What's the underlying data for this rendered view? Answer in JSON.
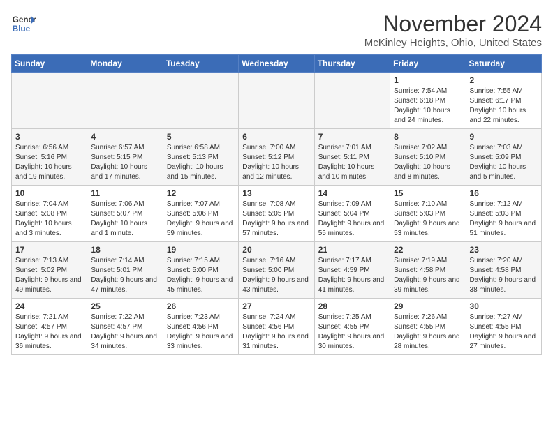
{
  "header": {
    "logo_line1": "General",
    "logo_line2": "Blue",
    "month": "November 2024",
    "location": "McKinley Heights, Ohio, United States"
  },
  "days_of_week": [
    "Sunday",
    "Monday",
    "Tuesday",
    "Wednesday",
    "Thursday",
    "Friday",
    "Saturday"
  ],
  "weeks": [
    [
      {
        "day": "",
        "info": ""
      },
      {
        "day": "",
        "info": ""
      },
      {
        "day": "",
        "info": ""
      },
      {
        "day": "",
        "info": ""
      },
      {
        "day": "",
        "info": ""
      },
      {
        "day": "1",
        "info": "Sunrise: 7:54 AM\nSunset: 6:18 PM\nDaylight: 10 hours\nand 24 minutes."
      },
      {
        "day": "2",
        "info": "Sunrise: 7:55 AM\nSunset: 6:17 PM\nDaylight: 10 hours\nand 22 minutes."
      }
    ],
    [
      {
        "day": "3",
        "info": "Sunrise: 6:56 AM\nSunset: 5:16 PM\nDaylight: 10 hours\nand 19 minutes."
      },
      {
        "day": "4",
        "info": "Sunrise: 6:57 AM\nSunset: 5:15 PM\nDaylight: 10 hours\nand 17 minutes."
      },
      {
        "day": "5",
        "info": "Sunrise: 6:58 AM\nSunset: 5:13 PM\nDaylight: 10 hours\nand 15 minutes."
      },
      {
        "day": "6",
        "info": "Sunrise: 7:00 AM\nSunset: 5:12 PM\nDaylight: 10 hours\nand 12 minutes."
      },
      {
        "day": "7",
        "info": "Sunrise: 7:01 AM\nSunset: 5:11 PM\nDaylight: 10 hours\nand 10 minutes."
      },
      {
        "day": "8",
        "info": "Sunrise: 7:02 AM\nSunset: 5:10 PM\nDaylight: 10 hours\nand 8 minutes."
      },
      {
        "day": "9",
        "info": "Sunrise: 7:03 AM\nSunset: 5:09 PM\nDaylight: 10 hours\nand 5 minutes."
      }
    ],
    [
      {
        "day": "10",
        "info": "Sunrise: 7:04 AM\nSunset: 5:08 PM\nDaylight: 10 hours\nand 3 minutes."
      },
      {
        "day": "11",
        "info": "Sunrise: 7:06 AM\nSunset: 5:07 PM\nDaylight: 10 hours\nand 1 minute."
      },
      {
        "day": "12",
        "info": "Sunrise: 7:07 AM\nSunset: 5:06 PM\nDaylight: 9 hours\nand 59 minutes."
      },
      {
        "day": "13",
        "info": "Sunrise: 7:08 AM\nSunset: 5:05 PM\nDaylight: 9 hours\nand 57 minutes."
      },
      {
        "day": "14",
        "info": "Sunrise: 7:09 AM\nSunset: 5:04 PM\nDaylight: 9 hours\nand 55 minutes."
      },
      {
        "day": "15",
        "info": "Sunrise: 7:10 AM\nSunset: 5:03 PM\nDaylight: 9 hours\nand 53 minutes."
      },
      {
        "day": "16",
        "info": "Sunrise: 7:12 AM\nSunset: 5:03 PM\nDaylight: 9 hours\nand 51 minutes."
      }
    ],
    [
      {
        "day": "17",
        "info": "Sunrise: 7:13 AM\nSunset: 5:02 PM\nDaylight: 9 hours\nand 49 minutes."
      },
      {
        "day": "18",
        "info": "Sunrise: 7:14 AM\nSunset: 5:01 PM\nDaylight: 9 hours\nand 47 minutes."
      },
      {
        "day": "19",
        "info": "Sunrise: 7:15 AM\nSunset: 5:00 PM\nDaylight: 9 hours\nand 45 minutes."
      },
      {
        "day": "20",
        "info": "Sunrise: 7:16 AM\nSunset: 5:00 PM\nDaylight: 9 hours\nand 43 minutes."
      },
      {
        "day": "21",
        "info": "Sunrise: 7:17 AM\nSunset: 4:59 PM\nDaylight: 9 hours\nand 41 minutes."
      },
      {
        "day": "22",
        "info": "Sunrise: 7:19 AM\nSunset: 4:58 PM\nDaylight: 9 hours\nand 39 minutes."
      },
      {
        "day": "23",
        "info": "Sunrise: 7:20 AM\nSunset: 4:58 PM\nDaylight: 9 hours\nand 38 minutes."
      }
    ],
    [
      {
        "day": "24",
        "info": "Sunrise: 7:21 AM\nSunset: 4:57 PM\nDaylight: 9 hours\nand 36 minutes."
      },
      {
        "day": "25",
        "info": "Sunrise: 7:22 AM\nSunset: 4:57 PM\nDaylight: 9 hours\nand 34 minutes."
      },
      {
        "day": "26",
        "info": "Sunrise: 7:23 AM\nSunset: 4:56 PM\nDaylight: 9 hours\nand 33 minutes."
      },
      {
        "day": "27",
        "info": "Sunrise: 7:24 AM\nSunset: 4:56 PM\nDaylight: 9 hours\nand 31 minutes."
      },
      {
        "day": "28",
        "info": "Sunrise: 7:25 AM\nSunset: 4:55 PM\nDaylight: 9 hours\nand 30 minutes."
      },
      {
        "day": "29",
        "info": "Sunrise: 7:26 AM\nSunset: 4:55 PM\nDaylight: 9 hours\nand 28 minutes."
      },
      {
        "day": "30",
        "info": "Sunrise: 7:27 AM\nSunset: 4:55 PM\nDaylight: 9 hours\nand 27 minutes."
      }
    ]
  ]
}
